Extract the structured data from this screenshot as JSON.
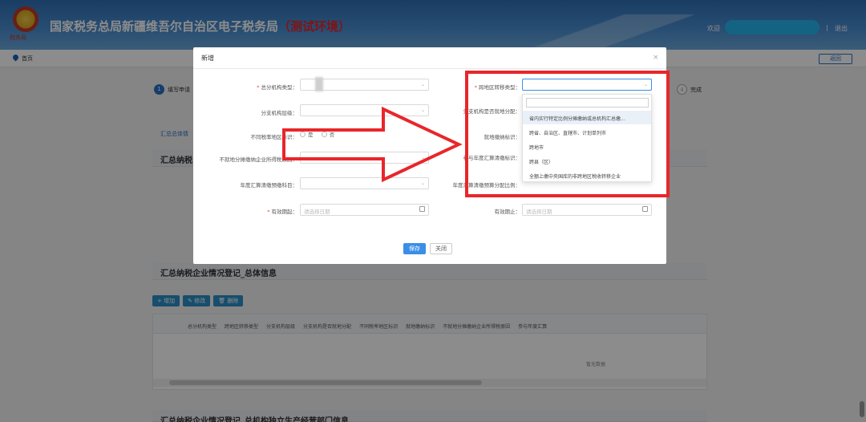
{
  "header": {
    "emblem_text": "税务局",
    "title": "国家税务总局新疆维吾尔自治区电子税务局",
    "env": "（测试环境）",
    "welcome": "欢迎",
    "separator": "|",
    "logout": "退出"
  },
  "nav": {
    "home": "首页",
    "back": "返回"
  },
  "background": {
    "step1_num": "1",
    "step1_label": "填写申请",
    "step4_num": "4",
    "step4_label": "完成",
    "tab": "汇总总体情",
    "section1": "汇总纳税",
    "section2": "汇总纳税企业情况登记_总体信息",
    "section3": "汇总纳税企业情况登记_总机构独立生产经营部门信息",
    "buttons": [
      "+ 增加",
      "✎ 修改",
      "🗑 删除"
    ],
    "table_headers": [
      "总分机构类型",
      "跨地区转移类型",
      "分支机构层级",
      "分支机构是否就地分配",
      "不同税率地区标识",
      "就地缴纳标识",
      "不就地分摊缴纳企业所得税原因",
      "参与年度汇算"
    ],
    "no_data": "暂无数据"
  },
  "dialog": {
    "title": "新增",
    "close": "×",
    "fields": {
      "zfjglx": "总分机构类型：",
      "fzjgcj": "分支机构层级：",
      "btslbs": "不同税率地区标识：",
      "radio_yes": "是",
      "radio_no": "否",
      "bjdftyy": "不就地分摊缴纳企业所得税原因：",
      "ndhsyj": "年度汇算清缴预缴科目：",
      "yxqq": "有效期起：",
      "yxqz": "有效期止：",
      "kdqzylx": "跨地区转移类型：",
      "fzjgsfjdfp": "分支机构是否就地分配：",
      "jdjnbs": "就地缴纳标识：",
      "cyndhs": "参与年度汇算清缴标识：",
      "ndhsfpbl": "年度汇算清缴预算分配比例：",
      "date_placeholder": "请选择日期"
    },
    "dropdown_options": [
      "省内实行特定比例分摊缴纳或总机构汇总缴...",
      "跨省、自治区、直辖市、计划单列市",
      "跨地市",
      "跨县（区）",
      "全额上缴中央国库的非跨地区税收转移企业"
    ],
    "save": "保存",
    "cancel": "关闭"
  },
  "colors": {
    "annotation": "#e8262b",
    "primary": "#3a8ee6",
    "header": "#2f6fb5"
  }
}
